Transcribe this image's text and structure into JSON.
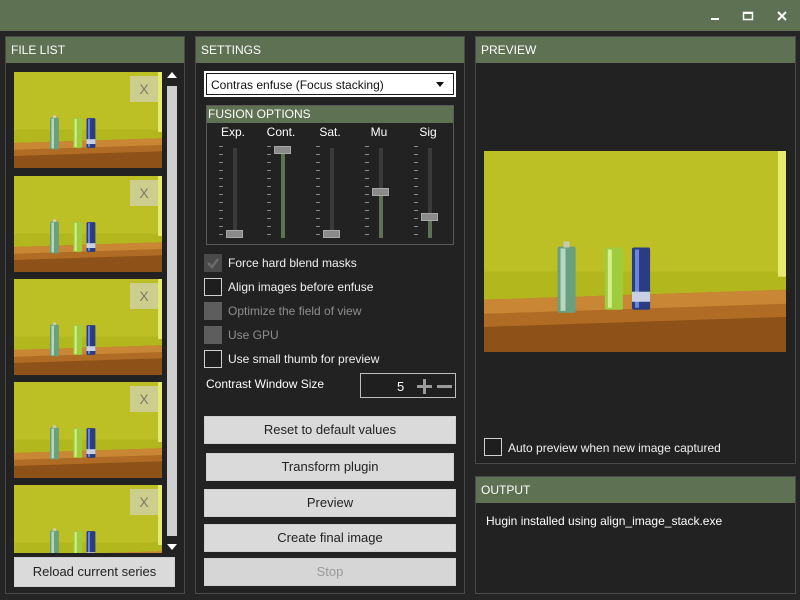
{
  "window": {
    "minimize": "",
    "maximize": "",
    "close": ""
  },
  "file_list": {
    "title": "FILE LIST",
    "remove_label": "X",
    "thumb_count": 5,
    "reload_label": "Reload current series"
  },
  "settings": {
    "title": "SETTINGS",
    "plugin_selected": "Contras enfuse (Focus stacking)",
    "fusion_title": "FUSION OPTIONS",
    "sliders": [
      {
        "label": "Exp.",
        "value": 0.0
      },
      {
        "label": "Cont.",
        "value": 1.0
      },
      {
        "label": "Sat.",
        "value": 0.0
      },
      {
        "label": "Mu",
        "value": 0.5
      },
      {
        "label": "Sig",
        "value": 0.2
      }
    ],
    "options": [
      {
        "label": "Force hard blend masks",
        "checked": true,
        "enabled": true
      },
      {
        "label": "Align images before enfuse",
        "checked": false,
        "enabled": true
      },
      {
        "label": "Optimize the field of view",
        "checked": false,
        "enabled": false
      },
      {
        "label": "Use GPU",
        "checked": false,
        "enabled": false
      },
      {
        "label": "Use small thumb for preview",
        "checked": false,
        "enabled": true
      }
    ],
    "contrast_window": {
      "label": "Contrast Window Size",
      "value": "5"
    },
    "buttons": {
      "reset": "Reset to default values",
      "transform": "Transform plugin",
      "preview": "Preview",
      "create": "Create final image",
      "stop": "Stop"
    }
  },
  "preview": {
    "title": "PREVIEW",
    "auto_preview_label": "Auto preview when new image captured",
    "auto_preview_checked": false
  },
  "output": {
    "title": "OUTPUT",
    "message": "Hugin installed using align_image_stack.exe"
  },
  "colors": {
    "accent": "#5e7253",
    "background": "#252525",
    "button": "#dadada",
    "wall": "#b4b81c",
    "table": "#c07828"
  }
}
